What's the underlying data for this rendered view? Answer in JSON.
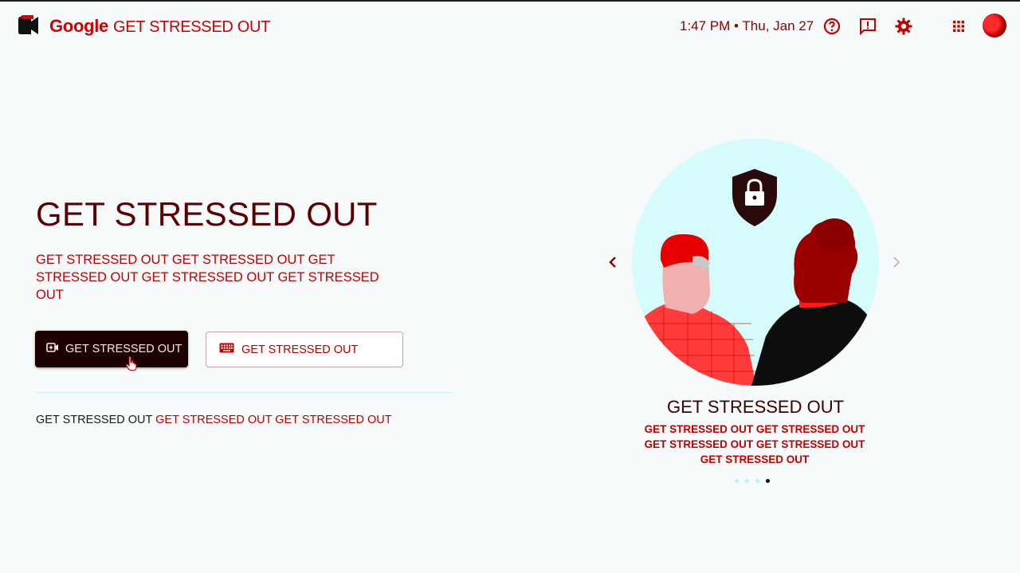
{
  "header": {
    "brand_google": "Google",
    "brand_product": "GET STRESSED OUT",
    "clock": "1:47 PM • Thu, Jan 27",
    "icons": [
      "help-icon",
      "feedback-icon",
      "settings-icon",
      "apps-grid-icon",
      "account-avatar"
    ]
  },
  "main": {
    "title": "GET STRESSED OUT",
    "subtitle": "GET STRESSED OUT GET STRESSED OUT GET STRESSED OUT GET STRESSED OUT GET STRESSED OUT",
    "primary_button": "GET STRESSED OUT",
    "secondary_button": "GET STRESSED OUT",
    "footer_text": "GET STRESSED OUT",
    "footer_link": "GET STRESSED OUT GET STRESSED OUT"
  },
  "carousel": {
    "slide_title": "GET STRESSED OUT",
    "slide_description": "GET STRESSED OUT GET STRESSED OUT GET STRESSED OUT GET STRESSED OUT GET STRESSED OUT",
    "page_count": 4,
    "active_page": 4
  },
  "colors": {
    "accent": "#c20000",
    "dark": "#1c0000",
    "circle_bg": "#d6fbfb",
    "page_bg": "#f7fafa"
  }
}
